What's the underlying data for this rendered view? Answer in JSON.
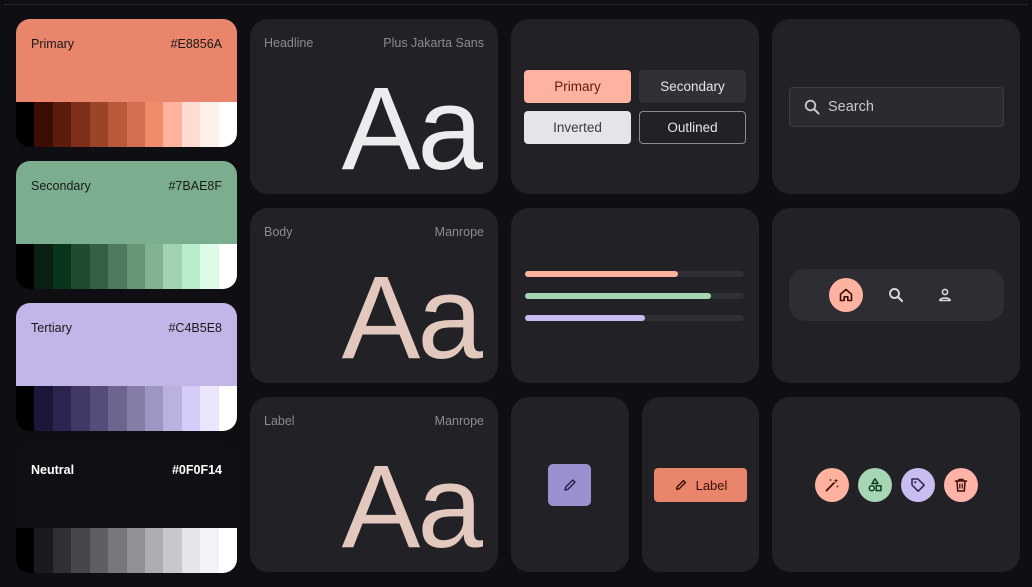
{
  "palette": [
    {
      "name": "Primary",
      "hex": "#E8856A",
      "base": "#e8856a",
      "tones": [
        "#000000",
        "#3b0d05",
        "#5c1c0c",
        "#7d2f19",
        "#9b4429",
        "#b9593b",
        "#d46e50",
        "#f28a6c",
        "#ffb39f",
        "#ffdbd2",
        "#fff0ec",
        "#ffffff"
      ]
    },
    {
      "name": "Secondary",
      "hex": "#7BAE8F",
      "base": "#7bae8f",
      "tones": [
        "#000000",
        "#0a2012",
        "#07341b",
        "#1f4b2f",
        "#366045",
        "#4f7a5d",
        "#679676",
        "#80b290",
        "#a1d3b1",
        "#b9ecc9",
        "#dcfbe6",
        "#ffffff"
      ]
    },
    {
      "name": "Tertiary",
      "hex": "#C4B5E8",
      "base": "#c4b5e8",
      "tones": [
        "#000000",
        "#1c1638",
        "#2d2550",
        "#413865",
        "#564c7a",
        "#6d6490",
        "#857ca8",
        "#9e96c2",
        "#bab1df",
        "#d6ccfa",
        "#ebe6fd",
        "#ffffff"
      ]
    },
    {
      "name": "Neutral",
      "hex": "#0F0F14",
      "base": "#0f0f14",
      "dark": true,
      "tones": [
        "#000000",
        "#1a1a1f",
        "#2f2f34",
        "#46464b",
        "#5e5e63",
        "#77777c",
        "#919196",
        "#acacb1",
        "#c7c7cc",
        "#e4e4e9",
        "#f2f2f7",
        "#ffffff"
      ]
    }
  ],
  "typography": [
    {
      "label": "Headline",
      "font": "Plus Jakarta Sans",
      "sample": "Aa",
      "color": "#ececef"
    },
    {
      "label": "Body",
      "font": "Manrope",
      "sample": "Aa",
      "color": "#e3c8be"
    },
    {
      "label": "Label",
      "font": "Manrope",
      "sample": "Aa",
      "color": "#e3c8be"
    }
  ],
  "buttons": {
    "primary": "Primary",
    "secondary": "Secondary",
    "inverted": "Inverted",
    "outlined": "Outlined"
  },
  "search": {
    "placeholder": "Search"
  },
  "progress": [
    {
      "fraction": 0.7,
      "color": "#ffb29f"
    },
    {
      "fraction": 0.85,
      "color": "#a6d6b4"
    },
    {
      "fraction": 0.55,
      "color": "#c8bcf0"
    }
  ],
  "chip": {
    "label": "Label"
  },
  "colors": {
    "primary_btn": "#ffb29f",
    "primary_btn_text": "#5c1c0c",
    "fab_bg": "#9b8fd0",
    "chip_bg": "#e8856a",
    "icon_pink": "#ffb29f",
    "icon_green": "#a6d6b4",
    "icon_purple": "#c8bcf0",
    "icon_salmon": "#ffb3a8"
  }
}
